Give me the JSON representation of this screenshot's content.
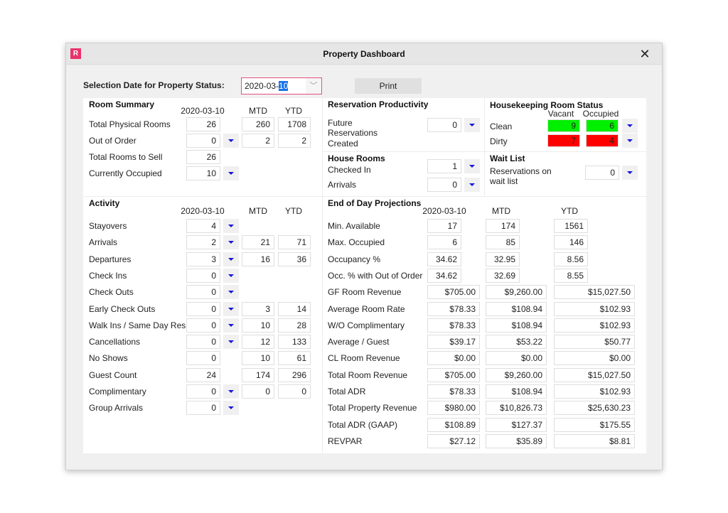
{
  "window": {
    "app_icon_letter": "R",
    "title": "Property Dashboard",
    "close_glyph": "✕"
  },
  "toolbar": {
    "selection_label": "Selection Date for Property Status:",
    "date_prefix": "2020-03-",
    "date_selected": "10",
    "dropdown_glyph": "﹀",
    "print_label": "Print"
  },
  "room_summary": {
    "title": "Room Summary",
    "col_headers": [
      "2020-03-10",
      "MTD",
      "YTD"
    ],
    "rows": [
      {
        "label": "Total Physical Rooms",
        "day": "26",
        "mtd": "260",
        "ytd": "1708"
      },
      {
        "label": "Out of Order",
        "day": "0",
        "mtd": "2",
        "ytd": "2"
      },
      {
        "label": "Total Rooms to Sell",
        "day": "26"
      },
      {
        "label": "Currently Occupied",
        "day": "10"
      }
    ]
  },
  "activity": {
    "title": "Activity",
    "col_headers": [
      "2020-03-10",
      "MTD",
      "YTD"
    ],
    "rows": [
      {
        "label": "Stayovers",
        "day": "4"
      },
      {
        "label": "Arrivals",
        "day": "2",
        "mtd": "21",
        "ytd": "71"
      },
      {
        "label": "Departures",
        "day": "3",
        "mtd": "16",
        "ytd": "36"
      },
      {
        "label": "Check Ins",
        "day": "0"
      },
      {
        "label": "Check Outs",
        "day": "0"
      },
      {
        "label": "Early Check Outs",
        "day": "0",
        "mtd": "3",
        "ytd": "14"
      },
      {
        "label": "Walk Ins / Same Day Res",
        "day": "0",
        "mtd": "10",
        "ytd": "28"
      },
      {
        "label": "Cancellations",
        "day": "0",
        "mtd": "12",
        "ytd": "133"
      },
      {
        "label": "No Shows",
        "day": "0",
        "mtd": "10",
        "ytd": "61"
      },
      {
        "label": "Guest Count",
        "day": "24",
        "mtd": "174",
        "ytd": "296"
      },
      {
        "label": "Complimentary",
        "day": "0",
        "mtd": "0",
        "ytd": "0"
      },
      {
        "label": "Group Arrivals",
        "day": "0"
      }
    ]
  },
  "reservation_productivity": {
    "title": "Reservation Productivity",
    "label_line1": "Future",
    "label_line2": "Reservations",
    "label_line3": "Created",
    "value": "0"
  },
  "house_rooms": {
    "title": "House Rooms",
    "rows": [
      {
        "label": "Checked In",
        "value": "1"
      },
      {
        "label": "Arrivals",
        "value": "0"
      }
    ]
  },
  "housekeeping": {
    "title": "Housekeeping Room Status",
    "col_headers": [
      "Vacant",
      "Occupied"
    ],
    "rows": [
      {
        "label": "Clean",
        "vacant": "9",
        "occupied": "6"
      },
      {
        "label": "Dirty",
        "vacant": "7",
        "occupied": "4"
      }
    ],
    "colors": {
      "clean": "#00f000",
      "dirty": "#ff0000"
    }
  },
  "wait_list": {
    "title": "Wait List",
    "label_line1": "Reservations on",
    "label_line2": "wait list",
    "value": "0"
  },
  "end_of_day": {
    "title": "End of Day Projections",
    "col_headers": [
      "2020-03-10",
      "MTD",
      "YTD"
    ],
    "rows": [
      {
        "label": "Min. Available",
        "day": "17",
        "mtd": "174",
        "ytd": "1561"
      },
      {
        "label": "Max. Occupied",
        "day": "6",
        "mtd": "85",
        "ytd": "146"
      },
      {
        "label": "Occupancy %",
        "day": "34.62",
        "mtd": "32.95",
        "ytd": "8.56"
      },
      {
        "label": "Occ. % with Out of Order",
        "day": "34.62",
        "mtd": "32.69",
        "ytd": "8.55"
      },
      {
        "label": "GF Room Revenue",
        "day": "$705.00",
        "mtd": "$9,260.00",
        "ytd": "$15,027.50"
      },
      {
        "label": "Average Room Rate",
        "day": "$78.33",
        "mtd": "$108.94",
        "ytd": "$102.93"
      },
      {
        "label": "W/O Complimentary",
        "day": "$78.33",
        "mtd": "$108.94",
        "ytd": "$102.93"
      },
      {
        "label": "Average / Guest",
        "day": "$39.17",
        "mtd": "$53.22",
        "ytd": "$50.77"
      },
      {
        "label": "CL Room Revenue",
        "day": "$0.00",
        "mtd": "$0.00",
        "ytd": "$0.00"
      },
      {
        "label": "Total Room Revenue",
        "day": "$705.00",
        "mtd": "$9,260.00",
        "ytd": "$15,027.50"
      },
      {
        "label": "Total ADR",
        "day": "$78.33",
        "mtd": "$108.94",
        "ytd": "$102.93"
      },
      {
        "label": "Total Property Revenue",
        "day": "$980.00",
        "mtd": "$10,826.73",
        "ytd": "$25,630.23"
      },
      {
        "label": "Total ADR (GAAP)",
        "day": "$108.89",
        "mtd": "$127.37",
        "ytd": "$175.55"
      },
      {
        "label": "REVPAR",
        "day": "$27.12",
        "mtd": "$35.89",
        "ytd": "$8.81"
      }
    ]
  }
}
